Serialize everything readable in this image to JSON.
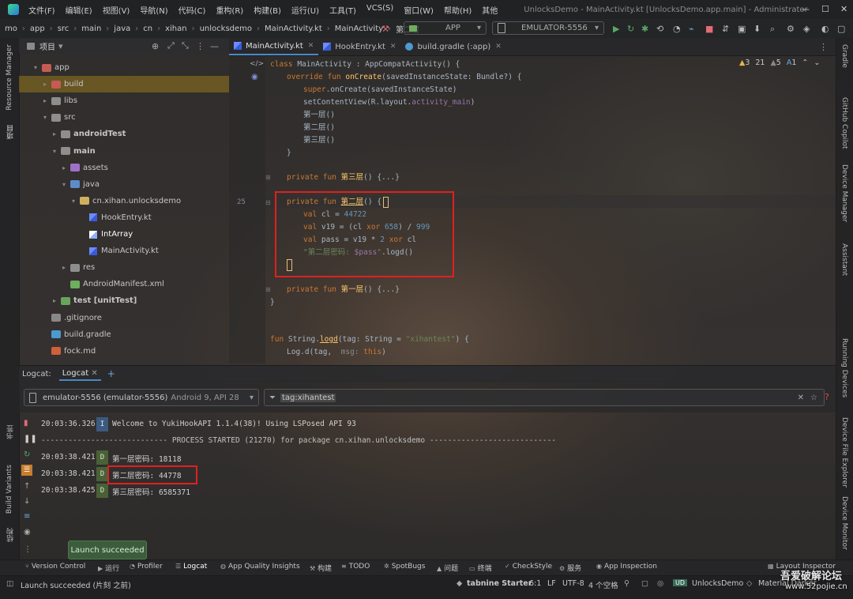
{
  "menu": {
    "items": [
      "文件(F)",
      "编辑(E)",
      "视图(V)",
      "导航(N)",
      "代码(C)",
      "重构(R)",
      "构建(B)",
      "运行(U)",
      "工具(T)",
      "VCS(S)",
      "窗口(W)",
      "帮助(H)",
      "其他"
    ]
  },
  "window": {
    "title": "UnlocksDemo - MainActivity.kt [UnlocksDemo.app.main] - Administrator"
  },
  "breadcrumb": [
    "mo",
    "app",
    "src",
    "main",
    "java",
    "cn",
    "xihan",
    "unlocksdemo",
    "MainActivity.kt",
    "MainActivity",
    "第二层"
  ],
  "run_config": "APP",
  "device_select": "EMULATOR-5556",
  "project_panel": {
    "title": "项目"
  },
  "tree": [
    {
      "label": "app",
      "indent": 0,
      "arrow": "▾",
      "icon": "folder-red",
      "type": "folder"
    },
    {
      "label": "build",
      "indent": 1,
      "arrow": "▸",
      "icon": "folder-red",
      "type": "folder",
      "selected": true
    },
    {
      "label": "libs",
      "indent": 1,
      "arrow": "▸",
      "icon": "folder",
      "type": "folder"
    },
    {
      "label": "src",
      "indent": 1,
      "arrow": "▾",
      "icon": "folder",
      "type": "folder"
    },
    {
      "label": "androidTest",
      "indent": 2,
      "arrow": "▸",
      "icon": "folder",
      "type": "folder"
    },
    {
      "label": "main",
      "indent": 2,
      "arrow": "▾",
      "icon": "folder",
      "type": "folder"
    },
    {
      "label": "assets",
      "indent": 3,
      "arrow": "▸",
      "icon": "folder-purple",
      "type": "folder"
    },
    {
      "label": "java",
      "indent": 3,
      "arrow": "▾",
      "icon": "folder-blue",
      "type": "folder"
    },
    {
      "label": "cn.xihan.unlocksdemo",
      "indent": 4,
      "arrow": "▾",
      "icon": "package",
      "type": "folder"
    },
    {
      "label": "HookEntry.kt",
      "indent": 5,
      "arrow": "",
      "icon": "kotlin",
      "type": "file"
    },
    {
      "label": "IntArray",
      "indent": 5,
      "arrow": "",
      "icon": "kotlin-class",
      "type": "file"
    },
    {
      "label": "MainActivity.kt",
      "indent": 5,
      "arrow": "",
      "icon": "kotlin",
      "type": "file"
    },
    {
      "label": "res",
      "indent": 3,
      "arrow": "▸",
      "icon": "folder",
      "type": "folder"
    },
    {
      "label": "AndroidManifest.xml",
      "indent": 3,
      "arrow": "",
      "icon": "xml",
      "type": "file"
    },
    {
      "label": "test [unitTest]",
      "indent": 2,
      "arrow": "▸",
      "icon": "folder-green",
      "type": "folder"
    },
    {
      "label": ".gitignore",
      "indent": 1,
      "arrow": "",
      "icon": "git",
      "type": "file"
    },
    {
      "label": "build.gradle",
      "indent": 1,
      "arrow": "",
      "icon": "gradle",
      "type": "file"
    },
    {
      "label": "fock.md",
      "indent": 1,
      "arrow": "",
      "icon": "md",
      "type": "file"
    }
  ],
  "editor_tabs": [
    {
      "label": "MainActivity.kt",
      "active": true
    },
    {
      "label": "HookEntry.kt",
      "active": false
    },
    {
      "label": "build.gradle (:app)",
      "active": false
    }
  ],
  "inspections": {
    "warnings": "3",
    "weak": "21",
    "typos": "5",
    "hints": "1"
  },
  "code_line_number": "25",
  "code": {
    "l1_kw": "class ",
    "l1_name": "MainActivity",
    "l1_rest": " : AppCompatActivity() {",
    "l2_kw": "override fun ",
    "l2_fn": "onCreate",
    "l2_rest": "(savedInstanceState: Bundle?) {",
    "l3_kw": "super",
    "l3_rest": ".onCreate(savedInstanceState)",
    "l4_fn": "setContentView",
    "l4_rest": "(R.layout.",
    "l4_res": "activity_main",
    "l4_end": ")",
    "l5": "第一层()",
    "l6": "第二层()",
    "l7": "第三层()",
    "l8": "}",
    "l9_kw": "private fun ",
    "l9_fn": "第三层",
    "l9_rest": "() {...}",
    "l10_kw": "private fun ",
    "l10_fn": "第二层",
    "l10_rest": "() {",
    "l11_kw": "val ",
    "l11_name": "cl",
    " l11_eq": " = ",
    "l11_num": "44722",
    "l12_kw": "val ",
    "l12_rest": "v19 = (cl ",
    "l12_xor": "xor",
    "l12_num1": " 658",
    ") ": "",
    "l12_div": ") / ",
    "l12_num2": "999",
    "l13_kw": "val ",
    "l13_rest": "pass = v19 * ",
    "l13_num": "2",
    " l13_xor": "xor",
    "l13_end": " cl",
    "l14_str": "\"第二层密码: ",
    "l14_var": "$pass",
    "l14_str_end": "\"",
    ".l14": "",
    "l14_call": ".logd()",
    "l15_kw": "private fun ",
    "l15_fn": "第一层",
    "l15_rest": "() {...}",
    "l16": "}",
    "l17_kw": "fun ",
    "l17_recv": "String.",
    "l17_fn": "logd",
    "l17_rest": "(tag: String = ",
    "l17_str": "\"xihantest\"",
    "l17_end": ") {",
    "l18_a": "Log.d(tag,  ",
    "l18_b": "msg: ",
    "l18_c": "this",
    ")": "",
    "l18_end": ")"
  },
  "logcat": {
    "tabs": [
      {
        "label": "Logcat:"
      },
      {
        "label": "Logcat"
      }
    ],
    "device": "emulator-5556 (emulator-5556)",
    "device_info": "Android 9, API 28",
    "filter": "tag:xihantest",
    "lines": [
      {
        "time": "20:03:36.326",
        "level": "I",
        "msg": "Welcome to YukiHookAPI 1.1.4(38)! Using LSPosed API 93"
      },
      {
        "separator": "---------------------------- PROCESS STARTED (21270) for package cn.xihan.unlocksdemo ----------------------------"
      },
      {
        "time": "20:03:38.421",
        "level": "D",
        "msg": "第一层密码: 18118"
      },
      {
        "time": "20:03:38.421",
        "level": "D",
        "msg": "第二层密码: 44778"
      },
      {
        "time": "20:03:38.425",
        "level": "D",
        "msg": "第三层密码: 6585371"
      }
    ]
  },
  "toast": "Launch succeeded",
  "left_labels": {
    "resource_manager": "Resource Manager",
    "project": "项目",
    "bookmarks": "书签",
    "build_variants": "Build Variants",
    "structure": "结构"
  },
  "right_labels": {
    "gradle": "Gradle",
    "copilot": "GitHub Copilot",
    "device_manager": "Device Manager",
    "assistant": "Assistant",
    "running_devices": "Running Devices",
    "file_explorer": "Device File Explorer",
    "monitor": "Device Monitor"
  },
  "tool_windows": [
    {
      "label": "Version Control",
      "icon": "branch-icon"
    },
    {
      "label": "运行",
      "icon": "play-icon"
    },
    {
      "label": "Profiler",
      "icon": "gauge-icon"
    },
    {
      "label": "Logcat",
      "icon": "logcat-icon"
    },
    {
      "label": "App Quality Insights",
      "icon": "insights-icon"
    },
    {
      "label": "构建",
      "icon": "hammer-icon"
    },
    {
      "label": "TODO",
      "icon": "list-icon"
    },
    {
      "label": "SpotBugs",
      "icon": "bug-icon"
    },
    {
      "label": "问题",
      "icon": "warning-icon"
    },
    {
      "label": "终端",
      "icon": "terminal-icon"
    },
    {
      "label": "CheckStyle",
      "icon": "check-icon"
    },
    {
      "label": "服务",
      "icon": "gear-icon"
    },
    {
      "label": "App Inspection",
      "icon": "inspect-icon"
    },
    {
      "label": "Layout Inspector",
      "icon": "layout-icon"
    }
  ],
  "status": {
    "message": "Launch succeeded (片刻 之前)",
    "tabnine": "tabnine Starter",
    "position": "6:1",
    "line_sep": "LF",
    "encoding": "UTF-8",
    "indent": "4 个空格",
    "project": "UnlocksDemo",
    "theme": "Material Darker"
  },
  "watermark": {
    "text": "吾爱破解论坛",
    "url": "www.52pojie.cn"
  }
}
